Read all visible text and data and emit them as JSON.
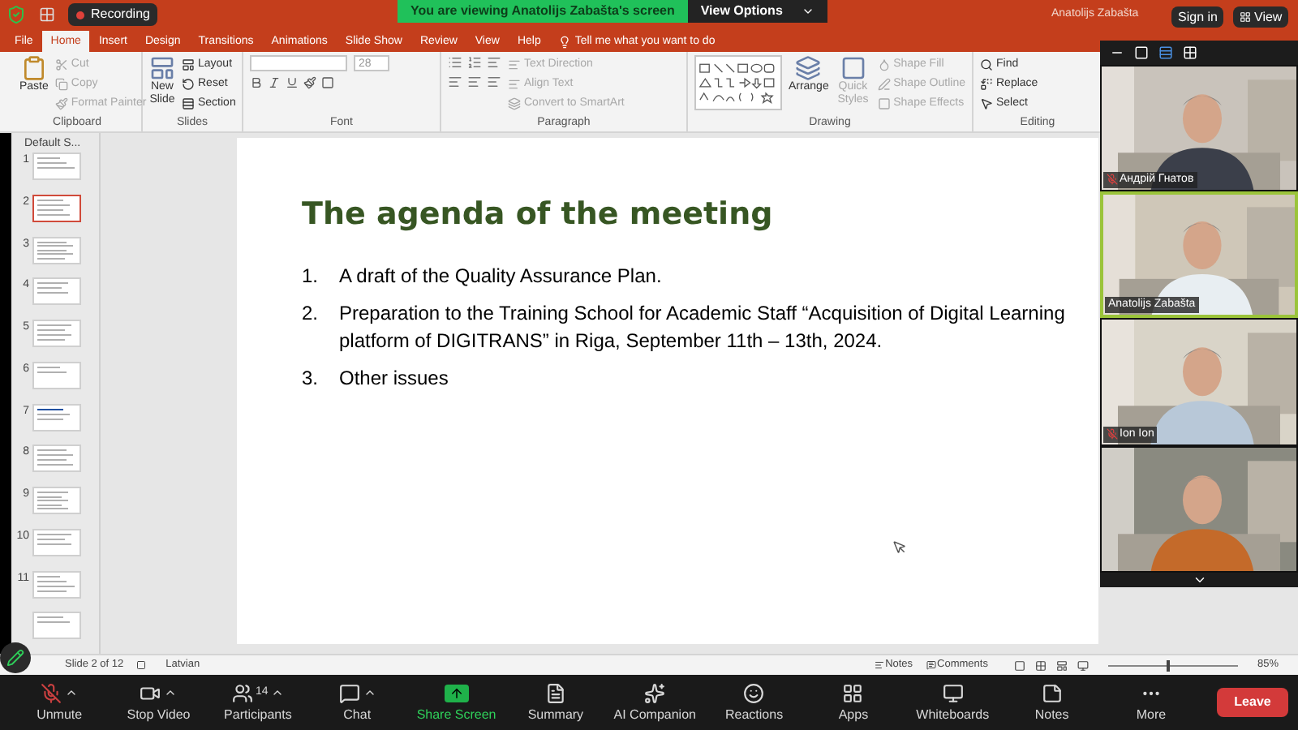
{
  "zoom_overlay": {
    "recording": "Recording",
    "banner": "You are viewing Anatolijs Zabašta's screen",
    "view_options": "View Options",
    "sign_in": "Sign in",
    "view": "View"
  },
  "title_bar": {
    "user": "Anatolijs Zabašta"
  },
  "ribbon_tabs": [
    {
      "label": "File",
      "selected": false
    },
    {
      "label": "Home",
      "selected": true
    },
    {
      "label": "Insert",
      "selected": false
    },
    {
      "label": "Design",
      "selected": false
    },
    {
      "label": "Transitions",
      "selected": false
    },
    {
      "label": "Animations",
      "selected": false
    },
    {
      "label": "Slide Show",
      "selected": false
    },
    {
      "label": "Review",
      "selected": false
    },
    {
      "label": "View",
      "selected": false
    },
    {
      "label": "Help",
      "selected": false
    }
  ],
  "tell_me": "Tell me what you want to do",
  "ribbon_groups": [
    {
      "label": "Clipboard",
      "items": [
        {
          "kind": "large",
          "label": "Paste",
          "disabled": false
        },
        {
          "kind": "small",
          "label": "Cut",
          "disabled": true
        },
        {
          "kind": "small",
          "label": "Copy",
          "disabled": true
        },
        {
          "kind": "small",
          "label": "Format Painter",
          "disabled": true
        }
      ]
    },
    {
      "label": "Slides",
      "items": [
        {
          "kind": "large",
          "label": "New Slide",
          "disabled": false
        },
        {
          "kind": "small",
          "label": "Layout",
          "disabled": false
        },
        {
          "kind": "small",
          "label": "Reset",
          "disabled": false
        },
        {
          "kind": "small",
          "label": "Section",
          "disabled": false
        }
      ]
    },
    {
      "label": "Font",
      "items": [
        {
          "kind": "font",
          "value": "28"
        }
      ]
    },
    {
      "label": "Paragraph",
      "items": [
        {
          "kind": "paragraph"
        },
        {
          "kind": "small",
          "label": "Text Direction",
          "disabled": true
        },
        {
          "kind": "small",
          "label": "Align Text",
          "disabled": true
        },
        {
          "kind": "small",
          "label": "Convert to SmartArt",
          "disabled": true
        }
      ]
    },
    {
      "label": "Drawing",
      "items": [
        {
          "kind": "shapes"
        },
        {
          "kind": "large",
          "label": "Arrange",
          "disabled": false
        },
        {
          "kind": "large",
          "label": "Quick Styles",
          "disabled": true
        },
        {
          "kind": "small",
          "label": "Shape Fill",
          "disabled": true
        },
        {
          "kind": "small",
          "label": "Shape Outline",
          "disabled": true
        },
        {
          "kind": "small",
          "label": "Shape Effects",
          "disabled": true
        }
      ]
    },
    {
      "label": "Editing",
      "items": [
        {
          "kind": "small",
          "label": "Find",
          "disabled": false
        },
        {
          "kind": "small",
          "label": "Replace",
          "disabled": false
        },
        {
          "kind": "small",
          "label": "Select",
          "disabled": false
        }
      ]
    }
  ],
  "thumbnails": {
    "section": "Default S...",
    "slides": [
      {
        "number": "1",
        "selected": false
      },
      {
        "number": "2",
        "selected": true
      },
      {
        "number": "3",
        "selected": false
      },
      {
        "number": "4",
        "selected": false
      },
      {
        "number": "5",
        "selected": false
      },
      {
        "number": "6",
        "selected": false
      },
      {
        "number": "7",
        "selected": false
      },
      {
        "number": "8",
        "selected": false
      },
      {
        "number": "9",
        "selected": false
      },
      {
        "number": "10",
        "selected": false
      },
      {
        "number": "11",
        "selected": false
      },
      {
        "selected": false
      }
    ]
  },
  "slide": {
    "title": "The agenda of the meeting",
    "items": [
      {
        "number": "1.",
        "text": "A draft of the Quality Assurance Plan."
      },
      {
        "number": "2.",
        "text": "Preparation to the Training School for Academic Staff “Acquisition of Digital Learning platform of DIGITRANS” in Riga, September 11th – 13th, 2024."
      },
      {
        "number": "3.",
        "text": "Other issues"
      }
    ]
  },
  "status_bar": {
    "slide_count": "Slide 2 of 12",
    "language": "Latvian",
    "notes": "Notes",
    "comments": "Comments",
    "zoom_slider": {
      "level": 0.45
    },
    "zoom": "85%"
  },
  "video_panel": {
    "view_modes": [
      {
        "selected": false
      },
      {
        "selected": false
      },
      {
        "selected": true
      },
      {
        "selected": false
      }
    ],
    "tiles": [
      {
        "name": "Андрій Гнатов",
        "muted": true,
        "speaking": false
      },
      {
        "name": "Anatolijs Zabašta",
        "muted": false,
        "speaking": true
      },
      {
        "name": "Ion Ion",
        "muted": true,
        "speaking": false
      },
      {
        "speaking": false
      }
    ]
  },
  "toolbar": {
    "items": [
      {
        "label": "Unmute",
        "caret": true
      },
      {
        "label": "Stop Video",
        "caret": true
      },
      {
        "label": "Participants",
        "caret": true,
        "count": "14"
      },
      {
        "label": "Chat",
        "caret": true
      },
      {
        "label": "Share Screen",
        "caret": false,
        "highlight": true
      },
      {
        "label": "Summary",
        "caret": false
      },
      {
        "label": "AI Companion",
        "caret": false
      },
      {
        "label": "Reactions",
        "caret": false
      },
      {
        "label": "Apps",
        "caret": false
      },
      {
        "label": "Whiteboards",
        "caret": false
      },
      {
        "label": "Notes",
        "caret": false
      },
      {
        "label": "More",
        "caret": false
      }
    ],
    "leave": "Leave"
  }
}
